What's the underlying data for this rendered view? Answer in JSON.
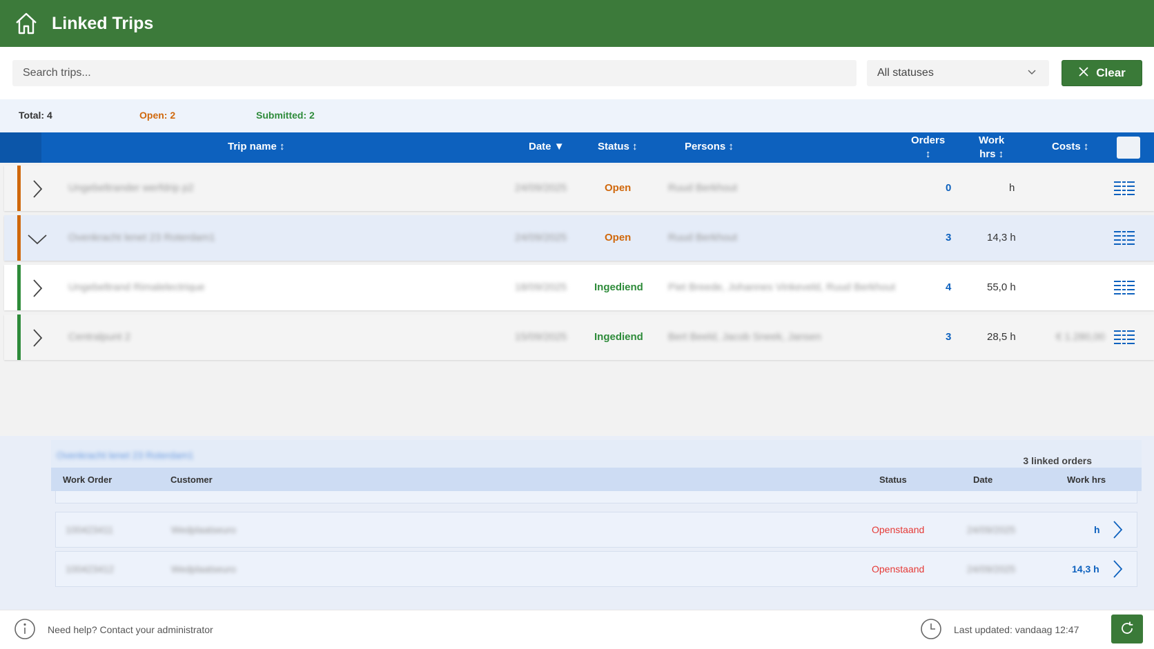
{
  "header": {
    "title": "Linked Trips",
    "icon": "home-icon"
  },
  "filters": {
    "search_placeholder": "Search trips...",
    "status_select": "All statuses",
    "clear_label": "Clear"
  },
  "stats": {
    "total": "Total: 4",
    "open": "Open: 2",
    "submitted": "Submitted: 2"
  },
  "table": {
    "columns": {
      "trip_name": "Trip name",
      "date": "Date",
      "status": "Status",
      "persons": "Persons",
      "orders_line1": "Orders",
      "workhrs_line1": "Work",
      "workhrs_line2": "hrs",
      "costs": "Costs"
    },
    "rows": [
      {
        "trip_name": "Ungebeltrander werfdrip p2",
        "date": "24/09/2025",
        "status": "Open",
        "persons": "Ruud Berkhout",
        "orders": "0",
        "work_hrs": "h",
        "costs": ""
      },
      {
        "trip_name": "Ovenkracht lenet 23 Roterdam1",
        "date": "24/09/2025",
        "status": "Open",
        "persons": "Ruud Berkhout",
        "orders": "3",
        "work_hrs": "14,3 h",
        "costs": ""
      },
      {
        "trip_name": "Ungebeltrand Rimalelectrique",
        "date": "18/09/2025",
        "status": "Ingediend",
        "persons": "Piet Breede, Johannes Vinkeveld, Ruud Berkhout",
        "orders": "4",
        "work_hrs": "55,0 h",
        "costs": ""
      },
      {
        "trip_name": "Centralpunt 2",
        "date": "15/09/2025",
        "status": "Ingediend",
        "persons": "Bert Beeld, Jacob Sneek, Jansen",
        "orders": "3",
        "work_hrs": "28,5 h",
        "costs": "€ 1.280,00"
      }
    ]
  },
  "detail": {
    "trip_title": "Ovenkracht lenet 23 Roterdam1",
    "linked_count": "3 linked orders",
    "columns": {
      "work_order": "Work Order",
      "customer": "Customer",
      "status": "Status",
      "date": "Date",
      "work_hrs": "Work hrs"
    },
    "rows": [
      {
        "work_order": "100423411",
        "customer": "Wedplaatseuro",
        "status": "Openstaand",
        "date": "24/09/2025",
        "work_hrs": "h"
      },
      {
        "work_order": "100423412",
        "customer": "Wedplaatseuro",
        "status": "Openstaand",
        "date": "24/09/2025",
        "work_hrs": "14,3 h"
      }
    ]
  },
  "footer": {
    "help": "Need help? Contact your administrator",
    "updated": "Last updated: vandaag 12:47"
  },
  "colors": {
    "header": "#3c7a3a",
    "table_header": "#0d61be",
    "open": "#d0680c",
    "submitted": "#2e8b3a",
    "openstaand": "#e53935"
  }
}
